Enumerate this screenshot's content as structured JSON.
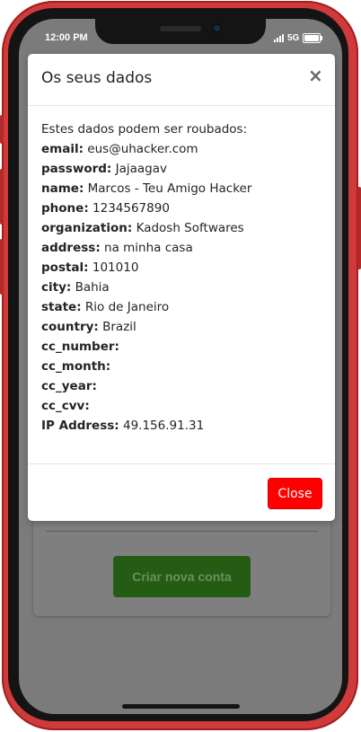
{
  "status_bar": {
    "time": "12:00 PM",
    "network": "5G"
  },
  "background_page": {
    "create_account_button": "Criar nova conta"
  },
  "modal": {
    "title": "Os seus dados",
    "close_x": "×",
    "intro": "Estes dados podem ser roubados:",
    "fields": [
      {
        "label": "email:",
        "value": "eus@uhacker.com"
      },
      {
        "label": "password:",
        "value": "Jajaagav"
      },
      {
        "label": "name:",
        "value": "Marcos - Teu Amigo Hacker"
      },
      {
        "label": "phone:",
        "value": "1234567890"
      },
      {
        "label": "organization:",
        "value": "Kadosh Softwares"
      },
      {
        "label": "address:",
        "value": "na minha casa"
      },
      {
        "label": "postal:",
        "value": "101010"
      },
      {
        "label": "city:",
        "value": "Bahia"
      },
      {
        "label": "state:",
        "value": "Rio de Janeiro"
      },
      {
        "label": "country:",
        "value": "Brazil"
      },
      {
        "label": "cc_number:",
        "value": ""
      },
      {
        "label": "cc_month:",
        "value": ""
      },
      {
        "label": "cc_year:",
        "value": ""
      },
      {
        "label": "cc_cvv:",
        "value": ""
      },
      {
        "label": "IP Address:",
        "value": "49.156.91.31"
      }
    ],
    "close_button": "Close"
  },
  "colors": {
    "phone_frame": "#d03a3a",
    "close_button": "#ff0000",
    "create_account_button": "#245c14",
    "overlay": "#7b7b7b"
  }
}
